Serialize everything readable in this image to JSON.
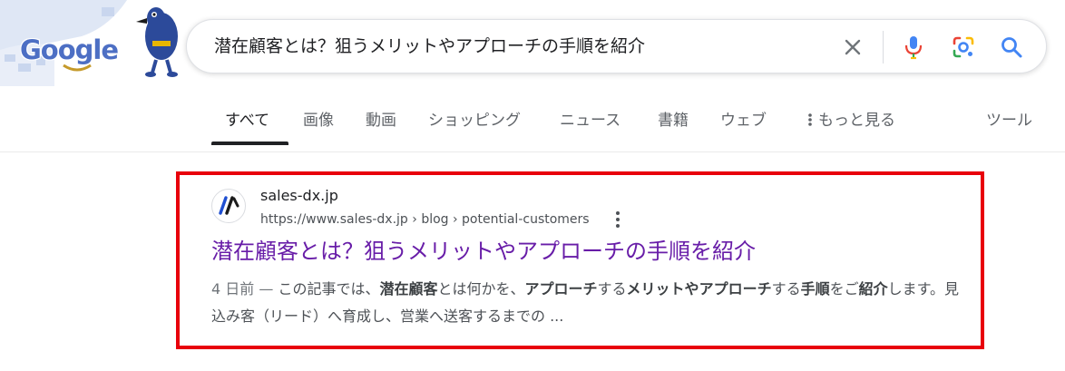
{
  "logo": {
    "text": "Google"
  },
  "search": {
    "query": "潜在顧客とは？狙うメリットやアプローチの手順を紹介",
    "icons": [
      "clear-icon",
      "microphone-icon",
      "lens-icon",
      "search-icon"
    ]
  },
  "tabs": {
    "items": [
      {
        "label": "すべて",
        "active": true
      },
      {
        "label": "画像"
      },
      {
        "label": "動画"
      },
      {
        "label": "ショッピング"
      },
      {
        "label": "ニュース"
      },
      {
        "label": "書籍"
      },
      {
        "label": "ウェブ"
      },
      {
        "label": "もっと見る"
      }
    ],
    "tools": "ツール"
  },
  "result": {
    "site_name": "sales-dx.jp",
    "url": "https://www.sales-dx.jp › blog › potential-customers",
    "title": "潜在顧客とは？狙うメリットやアプローチの手順を紹介",
    "snippet": [
      {
        "text": "4 日前 — ",
        "bold": false,
        "date": true
      },
      {
        "text": "この記事では、",
        "bold": false
      },
      {
        "text": "潜在顧客",
        "bold": true
      },
      {
        "text": "とは何かを、",
        "bold": false
      },
      {
        "text": "アプローチ",
        "bold": true
      },
      {
        "text": "する",
        "bold": false
      },
      {
        "text": "メリット",
        "bold": true
      },
      {
        "text": "や",
        "bold": true
      },
      {
        "text": "アプローチ",
        "bold": true
      },
      {
        "text": "する",
        "bold": false
      },
      {
        "text": "手順",
        "bold": true
      },
      {
        "text": "をご",
        "bold": false
      },
      {
        "text": "紹介",
        "bold": true
      },
      {
        "text": "します。見込み客（リード）へ育成し、営業へ送客するまでの ...",
        "bold": false
      }
    ]
  },
  "colors": {
    "highlight": "#e8000b",
    "visited_link": "#681da8",
    "google_blue": "#4285f4",
    "google_red": "#ea4335",
    "google_yellow": "#fbbc05",
    "google_green": "#34a853"
  }
}
